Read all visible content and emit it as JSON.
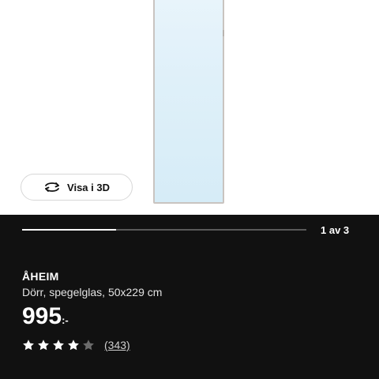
{
  "gallery": {
    "view3d_label": "Visa i 3D",
    "counter": "1 av 3",
    "progress_fraction": 0.33
  },
  "product": {
    "name": "ÅHEIM",
    "description": "Dörr, spegelglas, 50x229 cm",
    "price_value": "995",
    "price_suffix": ":-",
    "rating": 4,
    "rating_max": 5,
    "reviews": "(343)"
  },
  "colors": {
    "panel_bg": "#111111",
    "star_filled": "#ffffff",
    "star_empty": "#6b6b6b"
  },
  "icons": {
    "view3d": "rotate-3d-icon",
    "star": "star-icon"
  }
}
